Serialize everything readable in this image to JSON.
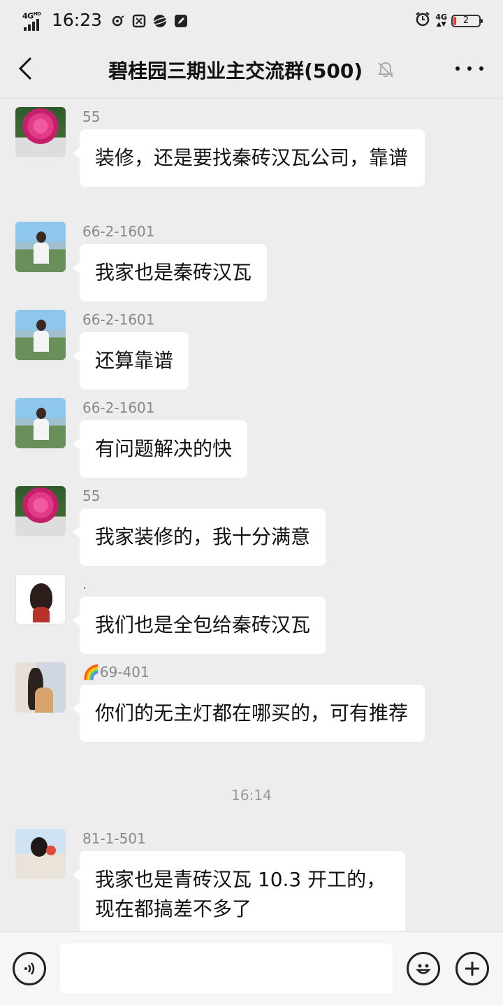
{
  "status_bar": {
    "network": "4G",
    "network_sup": "HD",
    "time": "16:23",
    "right_network": "4G",
    "battery": "2"
  },
  "header": {
    "title": "碧桂园三期业主交流群(500)"
  },
  "messages": [
    {
      "sender": "55",
      "text": "装修，还是要找秦砖汉瓦公司，靠谱"
    },
    {
      "sender": "66-2-1601",
      "text": "我家也是秦砖汉瓦"
    },
    {
      "sender": "66-2-1601",
      "text": "还算靠谱"
    },
    {
      "sender": "66-2-1601",
      "text": "有问题解决的快"
    },
    {
      "sender": "55",
      "text": "我家装修的，我十分满意"
    },
    {
      "sender": ".",
      "text": "我们也是全包给秦砖汉瓦"
    },
    {
      "sender": "🌈69-401",
      "text": "你们的无主灯都在哪买的，可有推荐"
    },
    {
      "sender": "81-1-501",
      "text": "我家也是青砖汉瓦 10.3 开工的，现在都搞差不多了"
    }
  ],
  "timestamp": "16:14",
  "input": {
    "value": ""
  }
}
